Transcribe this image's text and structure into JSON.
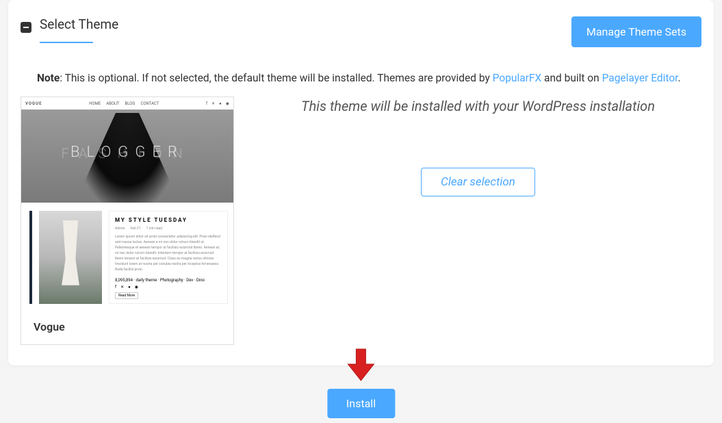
{
  "header": {
    "title": "Select Theme",
    "manage_btn": "Manage Theme Sets"
  },
  "note": {
    "bold": "Note",
    "text1": ": This is optional. If not selected, the default theme will be installed. Themes are provided by ",
    "link1": "PopularFX",
    "text2": " and built on ",
    "link2": "Pagelayer Editor",
    "text3": "."
  },
  "theme": {
    "name": "Vogue",
    "preview": {
      "brand": "VOGUE",
      "nav": [
        "HOME",
        "ABOUT",
        "BLOG",
        "CONTACT"
      ],
      "hero_back": "FASHION",
      "hero_front": "BLOGGER",
      "article_title": "MY STYLE TUESDAY",
      "article_meta": [
        "Admin",
        "Feb 21",
        "1 min read"
      ],
      "article_text": "Lorem ipsum dolor sit amet consectetur adipiscing elit. Proin eleifend sed massa luctus. Aenean a mi non dolor rutrum blandit ut. Pellentesque et aenean tempor at facilisis euismod libero. Aenean ac mi nec dolor rutrum blandit. Interdum tempor at facilisis euismod libero tempor at facilisis euismod. Class eu magna varius ultrices tincidunt lorem at nostra per conubia vestra per inceptos himenaeos. Nulla facilisi proin.",
      "article_footer": "8,095,894 · daily theme · Photography · Dev · Dino",
      "btn": "Read More"
    }
  },
  "right": {
    "install_msg": "This theme will be installed with your WordPress installation",
    "clear_btn": "Clear selection"
  },
  "footer": {
    "install_btn": "Install"
  }
}
